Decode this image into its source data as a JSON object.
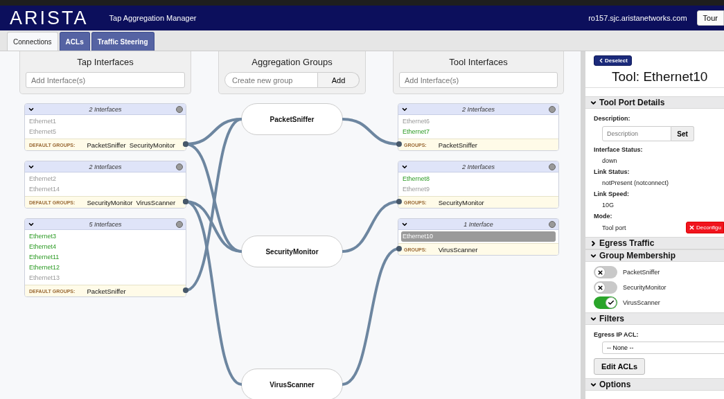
{
  "header": {
    "logo": "ARISTA",
    "app_title": "Tap Aggregation Manager",
    "host": "ro157.sjc.aristanetworks.com",
    "tour_button": "Tour"
  },
  "tabs": [
    {
      "label": "Connections",
      "selected": true
    },
    {
      "label": "ACLs",
      "selected": false
    },
    {
      "label": "Traffic Steering",
      "selected": false
    }
  ],
  "tap_interfaces": {
    "title": "Tap Interfaces",
    "placeholder": "Add Interface(s)",
    "cards": [
      {
        "count": "2 Interfaces",
        "interfaces": [
          {
            "name": "Ethernet1",
            "up": false,
            "selected": false
          },
          {
            "name": "Ethernet5",
            "up": false,
            "selected": false
          }
        ],
        "groups_label": "DEFAULT GROUPS:",
        "groups": [
          "PacketSniffer",
          "SecurityMonitor"
        ]
      },
      {
        "count": "2 Interfaces",
        "interfaces": [
          {
            "name": "Ethernet2",
            "up": false,
            "selected": false
          },
          {
            "name": "Ethernet14",
            "up": false,
            "selected": false
          }
        ],
        "groups_label": "DEFAULT GROUPS:",
        "groups": [
          "SecurityMonitor",
          "VirusScanner"
        ]
      },
      {
        "count": "5 Interfaces",
        "interfaces": [
          {
            "name": "Ethernet3",
            "up": true,
            "selected": false
          },
          {
            "name": "Ethernet4",
            "up": true,
            "selected": false
          },
          {
            "name": "Ethernet11",
            "up": true,
            "selected": false
          },
          {
            "name": "Ethernet12",
            "up": true,
            "selected": false
          },
          {
            "name": "Ethernet13",
            "up": false,
            "selected": false
          }
        ],
        "groups_label": "DEFAULT GROUPS:",
        "groups": [
          "PacketSniffer"
        ]
      }
    ]
  },
  "aggregation_groups": {
    "title": "Aggregation Groups",
    "placeholder": "Create new group",
    "add_button": "Add",
    "groups": [
      "PacketSniffer",
      "SecurityMonitor",
      "VirusScanner"
    ]
  },
  "tool_interfaces": {
    "title": "Tool Interfaces",
    "placeholder": "Add Interface(s)",
    "cards": [
      {
        "count": "2 Interfaces",
        "interfaces": [
          {
            "name": "Ethernet6",
            "up": false,
            "selected": false
          },
          {
            "name": "Ethernet7",
            "up": true,
            "selected": false
          }
        ],
        "groups_label": "GROUPS:",
        "groups": [
          "PacketSniffer"
        ]
      },
      {
        "count": "2 Interfaces",
        "interfaces": [
          {
            "name": "Ethernet8",
            "up": true,
            "selected": false
          },
          {
            "name": "Ethernet9",
            "up": false,
            "selected": false
          }
        ],
        "groups_label": "GROUPS:",
        "groups": [
          "SecurityMonitor"
        ]
      },
      {
        "count": "1 Interface",
        "interfaces": [
          {
            "name": "Ethernet10",
            "up": false,
            "selected": true
          }
        ],
        "groups_label": "GROUPS:",
        "groups": [
          "VirusScanner"
        ]
      }
    ]
  },
  "sidebar": {
    "deselect_button": "Deselect",
    "title": "Tool: Ethernet10",
    "sections": [
      {
        "kind": "details",
        "title": "Tool Port Details",
        "expanded": true,
        "description": {
          "label": "Description:",
          "placeholder": "Description",
          "button": "Set"
        },
        "fields": [
          {
            "label": "Interface Status:",
            "value": "down"
          },
          {
            "label": "Link Status:",
            "value": "notPresent (notconnect)"
          },
          {
            "label": "Link Speed:",
            "value": "10G"
          },
          {
            "label": "Mode:",
            "value": "Tool port",
            "action": "Deconfigu"
          }
        ]
      },
      {
        "title": "Egress Traffic",
        "expanded": false
      },
      {
        "kind": "membership",
        "title": "Group Membership",
        "expanded": true,
        "groups": [
          {
            "name": "PacketSniffer",
            "on": false
          },
          {
            "name": "SecurityMonitor",
            "on": false
          },
          {
            "name": "VirusScanner",
            "on": true
          }
        ]
      },
      {
        "kind": "filters",
        "title": "Filters",
        "expanded": true,
        "label": "Egress IP ACL:",
        "select": "-- None --",
        "button": "Edit ACLs"
      },
      {
        "title": "Options",
        "expanded": true
      }
    ]
  }
}
